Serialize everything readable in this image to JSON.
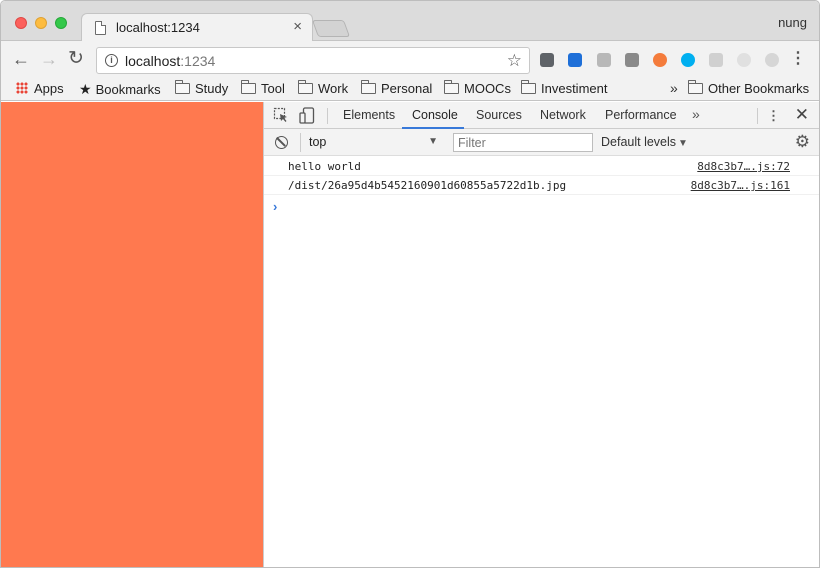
{
  "window": {
    "tab_title": "localhost:1234",
    "tab_close": "×",
    "profile_name": "nung"
  },
  "toolbar": {
    "back_icon": "←",
    "forward_icon": "→",
    "reload_icon": "↻",
    "info_icon": "i",
    "url_host": "localhost",
    "url_port": ":1234",
    "star_icon": "☆",
    "menu_icon": "⋮",
    "extensions": [
      {
        "name": "pocket-icon",
        "color": "#5f6368"
      },
      {
        "name": "vimium-icon",
        "color": "#1e6fd8"
      },
      {
        "name": "copy-icon",
        "color": "#b8b8b8"
      },
      {
        "name": "trello-icon",
        "color": "#8a8a8a"
      },
      {
        "name": "lifebuoy-icon",
        "color": "#f47c3c"
      },
      {
        "name": "skype-icon",
        "color": "#00aff0"
      },
      {
        "name": "key-icon",
        "color": "#d0d0d0"
      },
      {
        "name": "plus-icon",
        "color": "#e0e0e0"
      },
      {
        "name": "bulb-icon",
        "color": "#d6d6d6"
      }
    ]
  },
  "bookmarks": {
    "apps": "Apps",
    "items": [
      "Bookmarks",
      "Study",
      "Tool",
      "Work",
      "Personal",
      "MOOCs",
      "Investiment"
    ],
    "overflow": "»",
    "other": "Other Bookmarks"
  },
  "page": {
    "background": "#ff794f"
  },
  "devtools": {
    "tabs": [
      "Elements",
      "Console",
      "Sources",
      "Network",
      "Performance"
    ],
    "active_tab": "Console",
    "more": "»",
    "menu": "⋮",
    "close": "✕",
    "context": "top",
    "filter_placeholder": "Filter",
    "levels": "Default levels",
    "settings_icon": "⚙",
    "prompt": "›",
    "messages": [
      {
        "text": "hello world",
        "source": "8d8c3b7….js:72"
      },
      {
        "text": "/dist/26a95d4b5452160901d60855a5722d1b.jpg",
        "source": "8d8c3b7….js:161"
      }
    ]
  }
}
